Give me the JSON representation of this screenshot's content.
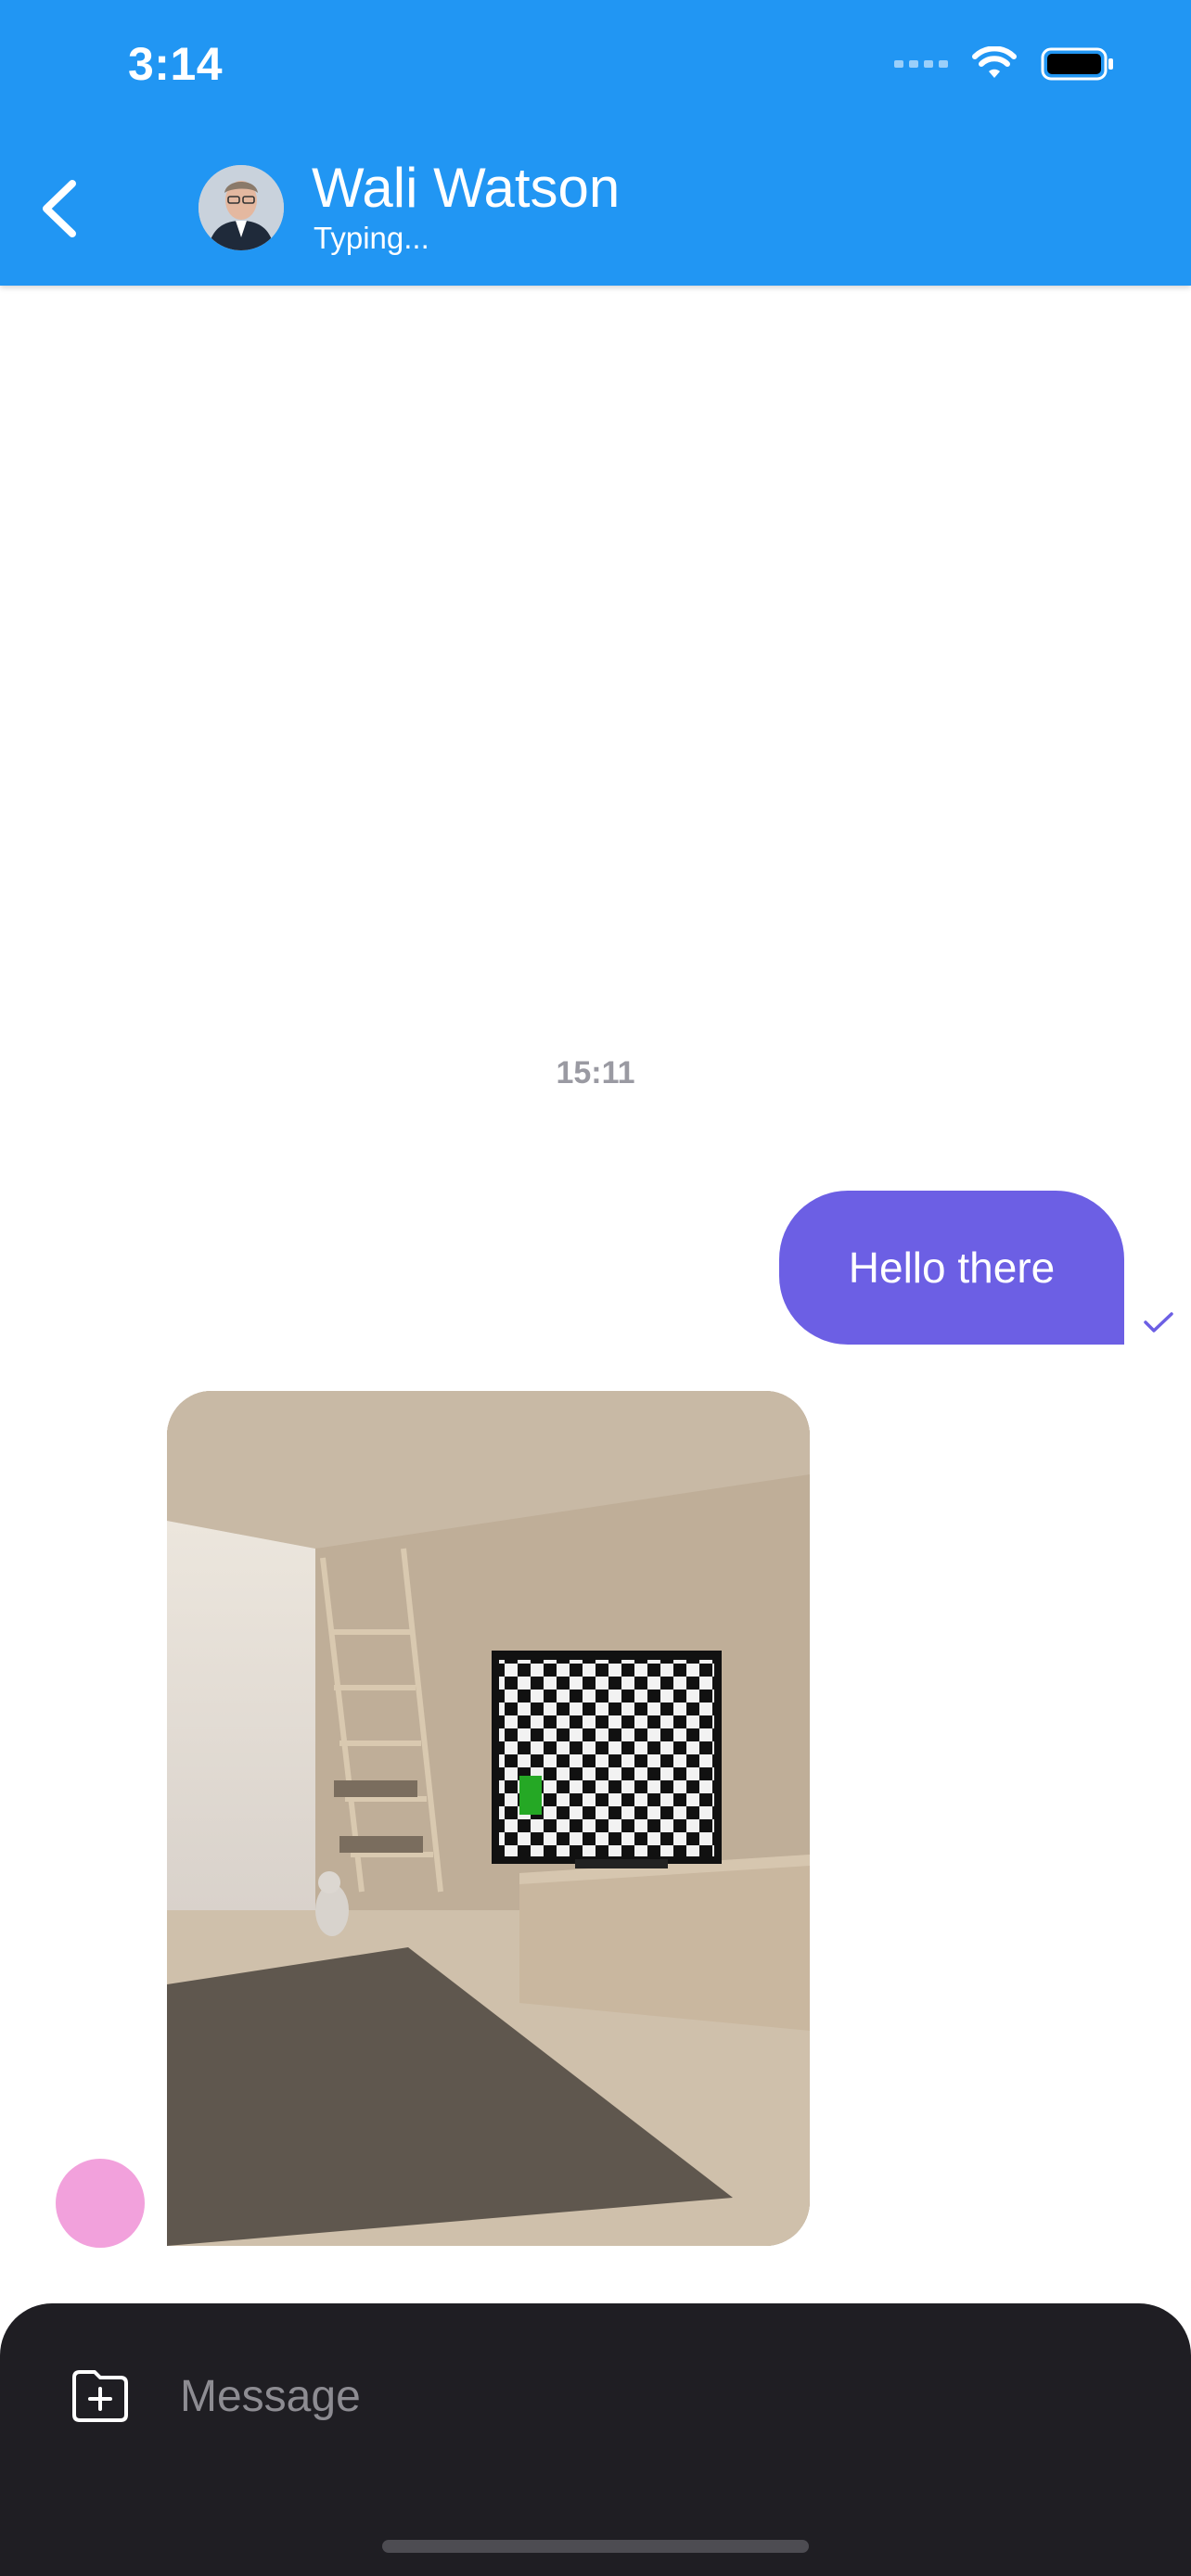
{
  "status_bar": {
    "time": "3:14"
  },
  "header": {
    "name": "Wali Watson",
    "status": "Typing..."
  },
  "messages": {
    "timestamp": "15:11",
    "outgoing": {
      "text": "Hello there",
      "status": "sent"
    }
  },
  "composer": {
    "placeholder": "Message"
  },
  "colors": {
    "header": "#2196F3",
    "outgoing_bubble": "#6C5FE4",
    "composer": "#1F1E23",
    "sender_avatar": "#F2A1DC"
  }
}
